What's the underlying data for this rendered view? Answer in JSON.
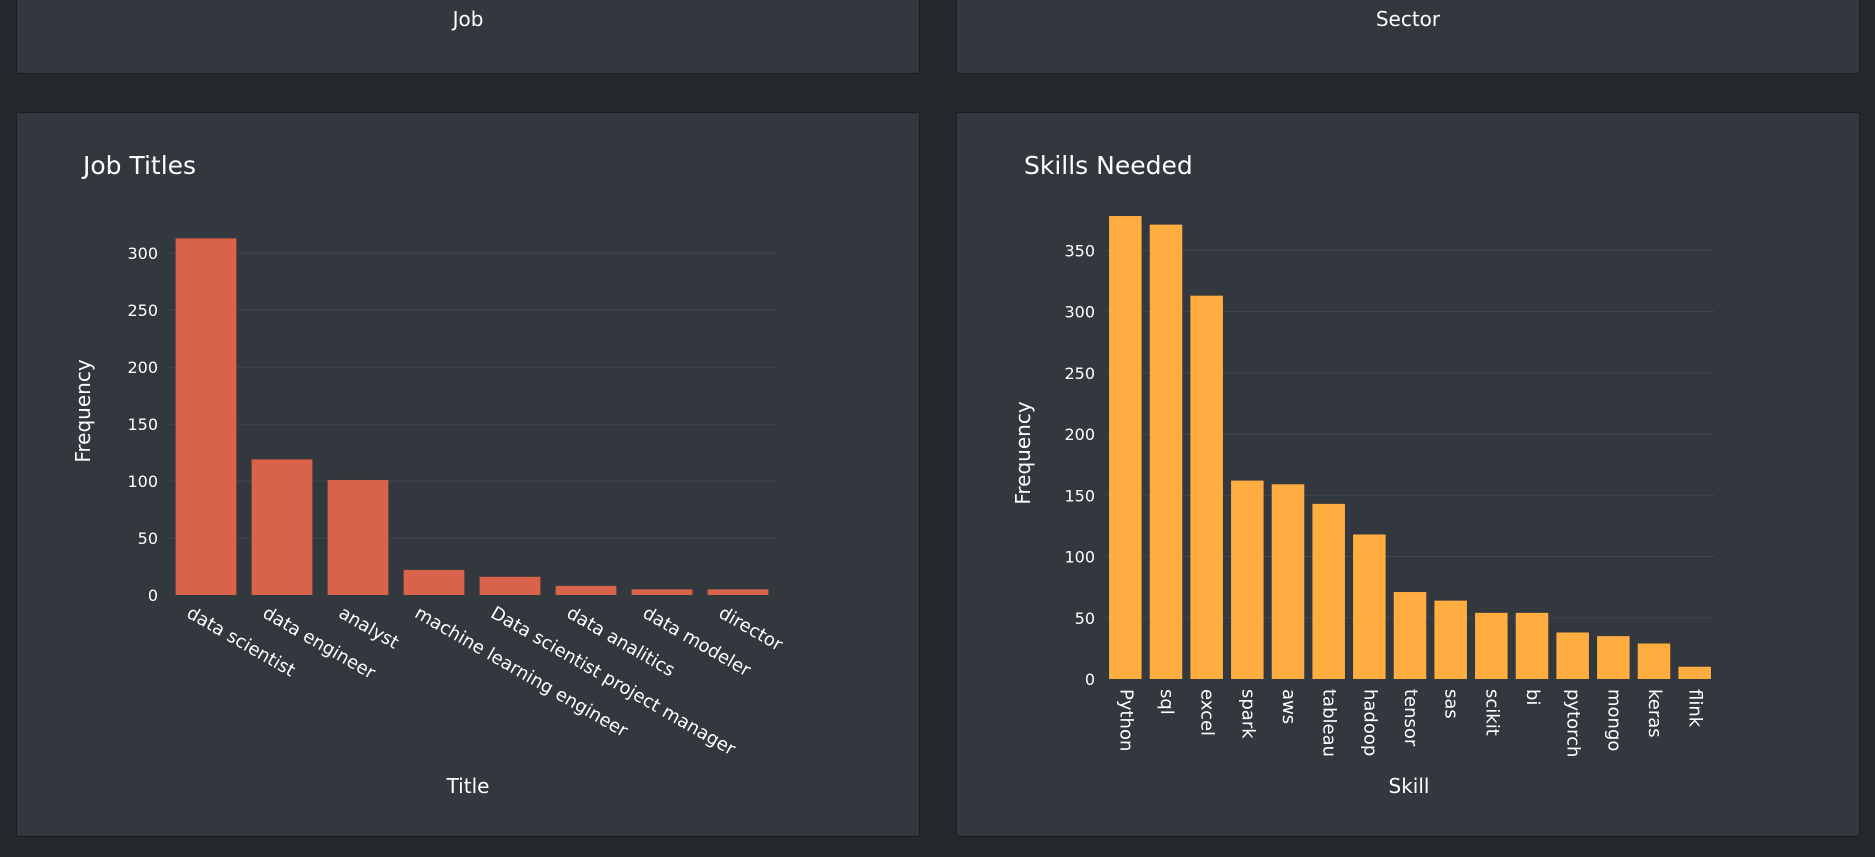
{
  "top_cards": [
    {
      "label": "Job"
    },
    {
      "label": "Sector"
    }
  ],
  "colors": {
    "background": "#25282c",
    "card": "#33373e",
    "text": "#ffffff",
    "grid": "#41464e",
    "job_bars": "#d8634a",
    "skill_bars": "#ffad41"
  },
  "chart_data": [
    {
      "type": "bar",
      "title": "Job Titles",
      "xlabel": "Title",
      "ylabel": "Frequency",
      "categories": [
        "data scientist",
        "data engineer",
        "analyst",
        "machine learning engineer",
        "Data scientist project manager",
        "data analitics",
        "data modeler",
        "director"
      ],
      "values": [
        313,
        119,
        101,
        22,
        16,
        8,
        5,
        5
      ],
      "yticks": [
        0,
        50,
        100,
        150,
        200,
        250,
        300
      ],
      "ylim": [
        0,
        330
      ],
      "tick_angle": 30,
      "color": "#d8634a"
    },
    {
      "type": "bar",
      "title": "Skills Needed",
      "xlabel": "Skill",
      "ylabel": "Frequency",
      "categories": [
        "Python",
        "sql",
        "excel",
        "spark",
        "aws",
        "tableau",
        "hadoop",
        "tensor",
        "sas",
        "scikit",
        "bi",
        "pytorch",
        "mongo",
        "keras",
        "flink"
      ],
      "values": [
        378,
        371,
        313,
        162,
        159,
        143,
        118,
        71,
        64,
        54,
        54,
        38,
        35,
        29,
        10
      ],
      "yticks": [
        0,
        50,
        100,
        150,
        200,
        250,
        300,
        350
      ],
      "ylim": [
        0,
        396
      ],
      "tick_angle": 90,
      "color": "#ffad41"
    }
  ]
}
